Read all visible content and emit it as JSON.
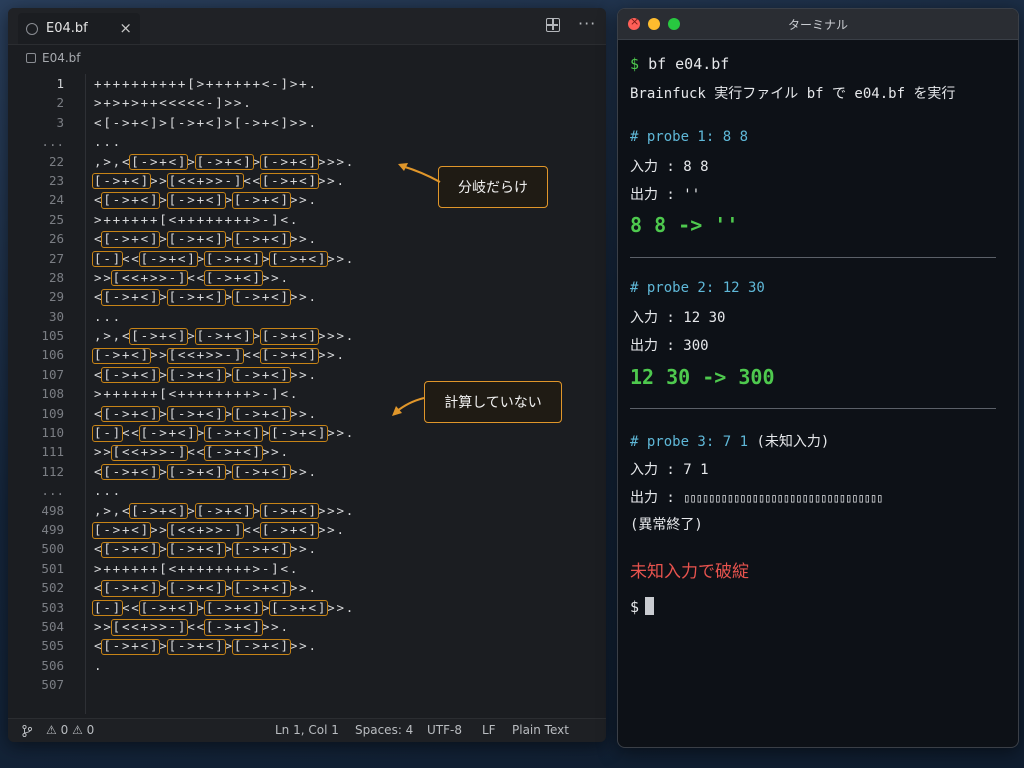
{
  "editor": {
    "tab_label": "E04.bf",
    "breadcrumb": "E04.bf",
    "lines": [
      {
        "num": "1",
        "text": "++++++++++[>++++++<-]>+."
      },
      {
        "num": "2",
        "text": ">+>+>++<<<<<-]>>."
      },
      {
        "num": "3",
        "text": "<[->+<]>[->+<]>[->+<]>>."
      },
      {
        "num": "...",
        "text": "..."
      },
      {
        "num": "22",
        "text": ",>,<[->+<]>[->+<]>[->+<]>>>."
      },
      {
        "num": "23",
        "text": "[->+<]>>[<<+>>-]<<[->+<]>>."
      },
      {
        "num": "24",
        "text": "<[->+<]>[->+<]>[->+<]>>."
      },
      {
        "num": "25",
        "text": ">++++++[<++++++++>-]<."
      },
      {
        "num": "26",
        "text": "<[->+<]>[->+<]>[->+<]>>."
      },
      {
        "num": "27",
        "text": "[-]<<[->+<]>[->+<]>[->+<]>>."
      },
      {
        "num": "28",
        "text": ">>[<<+>>-]<<[->+<]>>."
      },
      {
        "num": "29",
        "text": "<[->+<]>[->+<]>[->+<]>>."
      },
      {
        "num": "30",
        "text": "..."
      },
      {
        "num": "105",
        "text": ",>,<[->+<]>[->+<]>[->+<]>>>."
      },
      {
        "num": "106",
        "text": "[->+<]>>[<<+>>-]<<[->+<]>>."
      },
      {
        "num": "107",
        "text": "<[->+<]>[->+<]>[->+<]>>."
      },
      {
        "num": "108",
        "text": ">++++++[<++++++++>-]<."
      },
      {
        "num": "109",
        "text": "<[->+<]>[->+<]>[->+<]>>."
      },
      {
        "num": "110",
        "text": "[-]<<[->+<]>[->+<]>[->+<]>>."
      },
      {
        "num": "111",
        "text": ">>[<<+>>-]<<[->+<]>>."
      },
      {
        "num": "112",
        "text": "<[->+<]>[->+<]>[->+<]>>."
      },
      {
        "num": "...",
        "text": "..."
      },
      {
        "num": "498",
        "text": ",>,<[->+<]>[->+<]>[->+<]>>>."
      },
      {
        "num": "499",
        "text": "[->+<]>>[<<+>>-]<<[->+<]>>."
      },
      {
        "num": "500",
        "text": "<[->+<]>[->+<]>[->+<]>>."
      },
      {
        "num": "501",
        "text": ">++++++[<++++++++>-]<."
      },
      {
        "num": "502",
        "text": "<[->+<]>[->+<]>[->+<]>>."
      },
      {
        "num": "503",
        "text": "[-]<<[->+<]>[->+<]>[->+<]>>."
      },
      {
        "num": "504",
        "text": ">>[<<+>>-]<<[->+<]>>."
      },
      {
        "num": "505",
        "text": "<[->+<]>[->+<]>[->+<]>>."
      },
      {
        "num": "506",
        "text": "."
      },
      {
        "num": "507",
        "text": ""
      }
    ],
    "callout_branching": "分岐だらけ",
    "callout_no_calc": "計算していない",
    "status": {
      "errors": "0",
      "warnings": "0",
      "position": "Ln 1, Col 1",
      "spaces": "Spaces: 4",
      "encoding": "UTF-8",
      "eol": "LF",
      "language": "Plain Text"
    },
    "accent_color": "#e0962a"
  },
  "terminal": {
    "title": "ターミナル",
    "prompt": "$",
    "command": "bf e04.bf",
    "description": "Brainfuck 実行ファイル bf で e04.bf を実行",
    "probes": [
      {
        "header": "# probe 1: 8 8",
        "input": "入力 : 8 8",
        "output": "出力 : ''",
        "result": "8 8 -> ''"
      },
      {
        "header": "# probe 2: 12 30",
        "input": "入力 : 12 30",
        "output": "出力 : 300",
        "result": "12 30 -> 300"
      },
      {
        "header": "# probe 3: 7 1",
        "header_note": "(未知入力)",
        "input": "入力 : 7 1",
        "output_label": "出力 :",
        "output_garbage": "▯▯▯▯▯▯▯▯▯▯▯▯▯▯▯▯▯▯▯▯▯▯▯▯▯▯▯▯▯▯▯▯",
        "abnormal": "(異常終了)"
      }
    ],
    "failure_note": "未知入力で破綻",
    "final_prompt": "$",
    "colors": {
      "prompt": "#4ec94e",
      "probe_header": "#5fb8d8",
      "result": "#4ec94e",
      "failure": "#e8534e"
    }
  }
}
